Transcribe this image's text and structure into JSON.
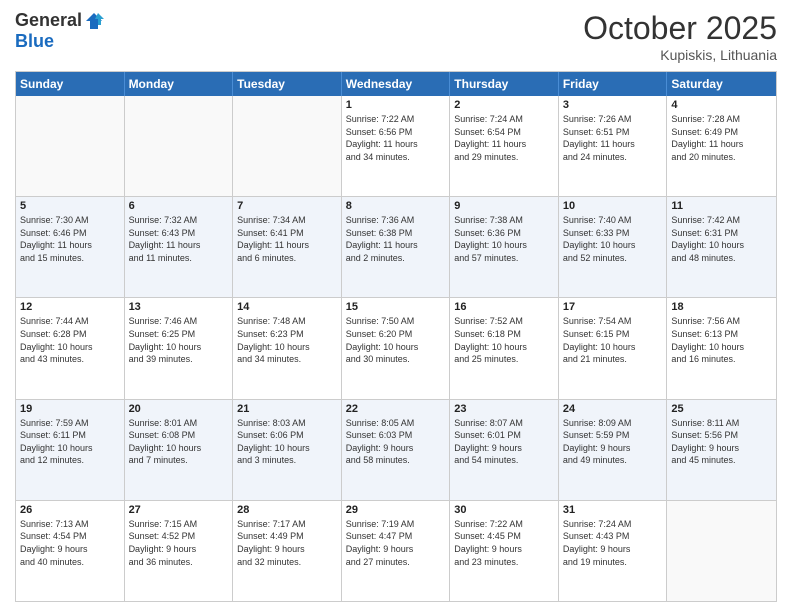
{
  "header": {
    "logo_general": "General",
    "logo_blue": "Blue",
    "month_title": "October 2025",
    "location": "Kupiskis, Lithuania"
  },
  "weekdays": [
    "Sunday",
    "Monday",
    "Tuesday",
    "Wednesday",
    "Thursday",
    "Friday",
    "Saturday"
  ],
  "rows": [
    [
      {
        "day": "",
        "info": ""
      },
      {
        "day": "",
        "info": ""
      },
      {
        "day": "",
        "info": ""
      },
      {
        "day": "1",
        "info": "Sunrise: 7:22 AM\nSunset: 6:56 PM\nDaylight: 11 hours\nand 34 minutes."
      },
      {
        "day": "2",
        "info": "Sunrise: 7:24 AM\nSunset: 6:54 PM\nDaylight: 11 hours\nand 29 minutes."
      },
      {
        "day": "3",
        "info": "Sunrise: 7:26 AM\nSunset: 6:51 PM\nDaylight: 11 hours\nand 24 minutes."
      },
      {
        "day": "4",
        "info": "Sunrise: 7:28 AM\nSunset: 6:49 PM\nDaylight: 11 hours\nand 20 minutes."
      }
    ],
    [
      {
        "day": "5",
        "info": "Sunrise: 7:30 AM\nSunset: 6:46 PM\nDaylight: 11 hours\nand 15 minutes."
      },
      {
        "day": "6",
        "info": "Sunrise: 7:32 AM\nSunset: 6:43 PM\nDaylight: 11 hours\nand 11 minutes."
      },
      {
        "day": "7",
        "info": "Sunrise: 7:34 AM\nSunset: 6:41 PM\nDaylight: 11 hours\nand 6 minutes."
      },
      {
        "day": "8",
        "info": "Sunrise: 7:36 AM\nSunset: 6:38 PM\nDaylight: 11 hours\nand 2 minutes."
      },
      {
        "day": "9",
        "info": "Sunrise: 7:38 AM\nSunset: 6:36 PM\nDaylight: 10 hours\nand 57 minutes."
      },
      {
        "day": "10",
        "info": "Sunrise: 7:40 AM\nSunset: 6:33 PM\nDaylight: 10 hours\nand 52 minutes."
      },
      {
        "day": "11",
        "info": "Sunrise: 7:42 AM\nSunset: 6:31 PM\nDaylight: 10 hours\nand 48 minutes."
      }
    ],
    [
      {
        "day": "12",
        "info": "Sunrise: 7:44 AM\nSunset: 6:28 PM\nDaylight: 10 hours\nand 43 minutes."
      },
      {
        "day": "13",
        "info": "Sunrise: 7:46 AM\nSunset: 6:25 PM\nDaylight: 10 hours\nand 39 minutes."
      },
      {
        "day": "14",
        "info": "Sunrise: 7:48 AM\nSunset: 6:23 PM\nDaylight: 10 hours\nand 34 minutes."
      },
      {
        "day": "15",
        "info": "Sunrise: 7:50 AM\nSunset: 6:20 PM\nDaylight: 10 hours\nand 30 minutes."
      },
      {
        "day": "16",
        "info": "Sunrise: 7:52 AM\nSunset: 6:18 PM\nDaylight: 10 hours\nand 25 minutes."
      },
      {
        "day": "17",
        "info": "Sunrise: 7:54 AM\nSunset: 6:15 PM\nDaylight: 10 hours\nand 21 minutes."
      },
      {
        "day": "18",
        "info": "Sunrise: 7:56 AM\nSunset: 6:13 PM\nDaylight: 10 hours\nand 16 minutes."
      }
    ],
    [
      {
        "day": "19",
        "info": "Sunrise: 7:59 AM\nSunset: 6:11 PM\nDaylight: 10 hours\nand 12 minutes."
      },
      {
        "day": "20",
        "info": "Sunrise: 8:01 AM\nSunset: 6:08 PM\nDaylight: 10 hours\nand 7 minutes."
      },
      {
        "day": "21",
        "info": "Sunrise: 8:03 AM\nSunset: 6:06 PM\nDaylight: 10 hours\nand 3 minutes."
      },
      {
        "day": "22",
        "info": "Sunrise: 8:05 AM\nSunset: 6:03 PM\nDaylight: 9 hours\nand 58 minutes."
      },
      {
        "day": "23",
        "info": "Sunrise: 8:07 AM\nSunset: 6:01 PM\nDaylight: 9 hours\nand 54 minutes."
      },
      {
        "day": "24",
        "info": "Sunrise: 8:09 AM\nSunset: 5:59 PM\nDaylight: 9 hours\nand 49 minutes."
      },
      {
        "day": "25",
        "info": "Sunrise: 8:11 AM\nSunset: 5:56 PM\nDaylight: 9 hours\nand 45 minutes."
      }
    ],
    [
      {
        "day": "26",
        "info": "Sunrise: 7:13 AM\nSunset: 4:54 PM\nDaylight: 9 hours\nand 40 minutes."
      },
      {
        "day": "27",
        "info": "Sunrise: 7:15 AM\nSunset: 4:52 PM\nDaylight: 9 hours\nand 36 minutes."
      },
      {
        "day": "28",
        "info": "Sunrise: 7:17 AM\nSunset: 4:49 PM\nDaylight: 9 hours\nand 32 minutes."
      },
      {
        "day": "29",
        "info": "Sunrise: 7:19 AM\nSunset: 4:47 PM\nDaylight: 9 hours\nand 27 minutes."
      },
      {
        "day": "30",
        "info": "Sunrise: 7:22 AM\nSunset: 4:45 PM\nDaylight: 9 hours\nand 23 minutes."
      },
      {
        "day": "31",
        "info": "Sunrise: 7:24 AM\nSunset: 4:43 PM\nDaylight: 9 hours\nand 19 minutes."
      },
      {
        "day": "",
        "info": ""
      }
    ]
  ]
}
